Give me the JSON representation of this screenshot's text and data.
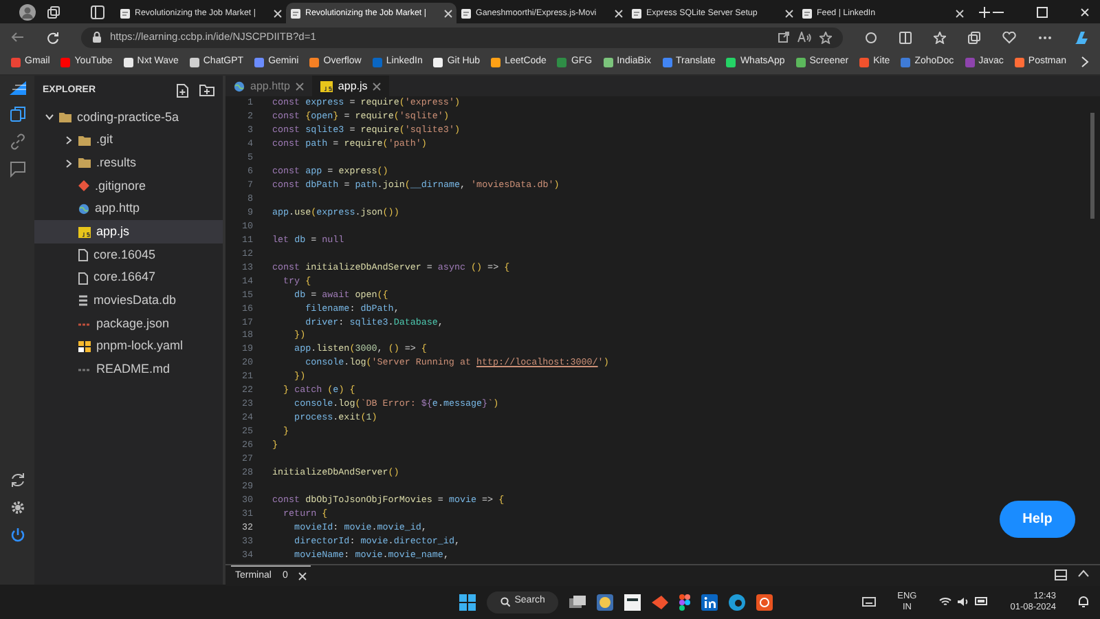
{
  "browser": {
    "tabs": [
      {
        "title": "Revolutionizing the Job Market |",
        "selected": false
      },
      {
        "title": "Revolutionizing the Job Market |",
        "selected": true
      },
      {
        "title": "Ganeshmoorthi/Express.js-Movi",
        "selected": false
      },
      {
        "title": "Express SQLite Server Setup",
        "selected": false
      },
      {
        "title": "Feed | LinkedIn",
        "selected": false
      }
    ],
    "address": "https://learning.ccbp.in/ide/NJSCPDIITB?d=1",
    "bookmarks": [
      {
        "label": "Gmail",
        "color": "#ea4335"
      },
      {
        "label": "YouTube",
        "color": "#ff0000"
      },
      {
        "label": "Nxt Wave",
        "color": "#e8e8e8"
      },
      {
        "label": "ChatGPT",
        "color": "#cfcfcf"
      },
      {
        "label": "Gemini",
        "color": "#6b8cff"
      },
      {
        "label": "Overflow",
        "color": "#f48024"
      },
      {
        "label": "LinkedIn",
        "color": "#0a66c2"
      },
      {
        "label": "Git Hub",
        "color": "#f0f0f0"
      },
      {
        "label": "LeetCode",
        "color": "#ffa116"
      },
      {
        "label": "GFG",
        "color": "#2f8d46"
      },
      {
        "label": "IndiaBix",
        "color": "#7cc47c"
      },
      {
        "label": "Translate",
        "color": "#4285f4"
      },
      {
        "label": "WhatsApp",
        "color": "#25d366"
      },
      {
        "label": "Screener",
        "color": "#5cb85c"
      },
      {
        "label": "Kite",
        "color": "#f0522d"
      },
      {
        "label": "ZohoDoc",
        "color": "#3f7bd6"
      },
      {
        "label": "Javac",
        "color": "#8e44ad"
      },
      {
        "label": "Postman",
        "color": "#ff6c37"
      }
    ]
  },
  "ide": {
    "explorer": {
      "title": "EXPLORER",
      "tree": [
        {
          "label": "coding-practice-5a",
          "kind": "folder",
          "expanded": true,
          "selected": false,
          "children": [
            {
              "label": ".git",
              "kind": "folder",
              "expanded": false,
              "selected": false
            },
            {
              "label": ".results",
              "kind": "folder",
              "expanded": false,
              "selected": false
            },
            {
              "label": ".gitignore",
              "kind": "git",
              "selected": false
            },
            {
              "label": "app.http",
              "kind": "http",
              "selected": false
            },
            {
              "label": "app.js",
              "kind": "js",
              "selected": true
            },
            {
              "label": "core.16045",
              "kind": "file",
              "selected": false
            },
            {
              "label": "core.16647",
              "kind": "file",
              "selected": false
            },
            {
              "label": "moviesData.db",
              "kind": "db",
              "selected": false
            },
            {
              "label": "package.json",
              "kind": "json",
              "selected": false
            },
            {
              "label": "pnpm-lock.yaml",
              "kind": "yaml",
              "selected": false
            },
            {
              "label": "README.md",
              "kind": "md",
              "selected": false
            }
          ]
        }
      ]
    },
    "editor": {
      "tabs": [
        {
          "label": "app.http",
          "kind": "http",
          "selected": false
        },
        {
          "label": "app.js",
          "kind": "js",
          "selected": true
        }
      ],
      "lines": [
        {
          "number": "1",
          "current": false,
          "tokens": [
            {
              "kind": "keyword",
              "text": "const "
            },
            {
              "kind": "variable",
              "text": "express"
            },
            {
              "kind": "plain",
              "text": " = "
            },
            {
              "kind": "function",
              "text": "require"
            },
            {
              "kind": "bracket",
              "text": "("
            },
            {
              "kind": "string",
              "text": "'express'"
            },
            {
              "kind": "bracket",
              "text": ")"
            }
          ]
        },
        {
          "number": "2",
          "current": false,
          "tokens": [
            {
              "kind": "keyword",
              "text": "const "
            },
            {
              "kind": "bracket",
              "text": "{"
            },
            {
              "kind": "variable",
              "text": "open"
            },
            {
              "kind": "bracket",
              "text": "}"
            },
            {
              "kind": "plain",
              "text": " = "
            },
            {
              "kind": "function",
              "text": "require"
            },
            {
              "kind": "bracket",
              "text": "("
            },
            {
              "kind": "string",
              "text": "'sqlite'"
            },
            {
              "kind": "bracket",
              "text": ")"
            }
          ]
        },
        {
          "number": "3",
          "current": false,
          "tokens": [
            {
              "kind": "keyword",
              "text": "const "
            },
            {
              "kind": "variable",
              "text": "sqlite3"
            },
            {
              "kind": "plain",
              "text": " = "
            },
            {
              "kind": "function",
              "text": "require"
            },
            {
              "kind": "bracket",
              "text": "("
            },
            {
              "kind": "string",
              "text": "'sqlite3'"
            },
            {
              "kind": "bracket",
              "text": ")"
            }
          ]
        },
        {
          "number": "4",
          "current": false,
          "tokens": [
            {
              "kind": "keyword",
              "text": "const "
            },
            {
              "kind": "variable",
              "text": "path"
            },
            {
              "kind": "plain",
              "text": " = "
            },
            {
              "kind": "function",
              "text": "require"
            },
            {
              "kind": "bracket",
              "text": "("
            },
            {
              "kind": "string",
              "text": "'path'"
            },
            {
              "kind": "bracket",
              "text": ")"
            }
          ]
        },
        {
          "number": "5",
          "current": false
        },
        {
          "number": "6",
          "current": false,
          "tokens": [
            {
              "kind": "keyword",
              "text": "const "
            },
            {
              "kind": "variable",
              "text": "app"
            },
            {
              "kind": "plain",
              "text": " = "
            },
            {
              "kind": "function",
              "text": "express"
            },
            {
              "kind": "bracket",
              "text": "()"
            }
          ]
        },
        {
          "number": "7",
          "current": false,
          "tokens": [
            {
              "kind": "keyword",
              "text": "const "
            },
            {
              "kind": "variable",
              "text": "dbPath"
            },
            {
              "kind": "plain",
              "text": " = "
            },
            {
              "kind": "variable",
              "text": "path"
            },
            {
              "kind": "plain",
              "text": "."
            },
            {
              "kind": "function",
              "text": "join"
            },
            {
              "kind": "bracket",
              "text": "("
            },
            {
              "kind": "variable",
              "text": "__dirname"
            },
            {
              "kind": "plain",
              "text": ", "
            },
            {
              "kind": "string",
              "text": "'moviesData.db'"
            },
            {
              "kind": "bracket",
              "text": ")"
            }
          ]
        },
        {
          "number": "8",
          "current": false
        },
        {
          "number": "9",
          "current": false,
          "tokens": [
            {
              "kind": "variable",
              "text": "app"
            },
            {
              "kind": "plain",
              "text": "."
            },
            {
              "kind": "function",
              "text": "use"
            },
            {
              "kind": "bracket",
              "text": "("
            },
            {
              "kind": "variable",
              "text": "express"
            },
            {
              "kind": "plain",
              "text": "."
            },
            {
              "kind": "function",
              "text": "json"
            },
            {
              "kind": "bracket",
              "text": "())"
            }
          ]
        },
        {
          "number": "10",
          "current": false
        },
        {
          "number": "11",
          "current": false,
          "tokens": [
            {
              "kind": "keyword",
              "text": "let "
            },
            {
              "kind": "variable",
              "text": "db"
            },
            {
              "kind": "plain",
              "text": " = "
            },
            {
              "kind": "keyword",
              "text": "null"
            }
          ]
        },
        {
          "number": "12",
          "current": false
        },
        {
          "number": "13",
          "current": false,
          "tokens": [
            {
              "kind": "keyword",
              "text": "const "
            },
            {
              "kind": "function",
              "text": "initializeDbAndServer"
            },
            {
              "kind": "plain",
              "text": " = "
            },
            {
              "kind": "keyword",
              "text": "async "
            },
            {
              "kind": "bracket",
              "text": "()"
            },
            {
              "kind": "plain",
              "text": " => "
            },
            {
              "kind": "bracket",
              "text": "{"
            }
          ]
        },
        {
          "number": "14",
          "current": false,
          "tokens": [
            {
              "kind": "keyword",
              "text": "  try "
            },
            {
              "kind": "bracket",
              "text": "{"
            }
          ]
        },
        {
          "number": "15",
          "current": false,
          "tokens": [
            {
              "kind": "variable",
              "text": "    db"
            },
            {
              "kind": "plain",
              "text": " = "
            },
            {
              "kind": "keyword",
              "text": "await "
            },
            {
              "kind": "function",
              "text": "open"
            },
            {
              "kind": "bracket",
              "text": "({"
            }
          ]
        },
        {
          "number": "16",
          "current": false,
          "tokens": [
            {
              "kind": "variable",
              "text": "      filename"
            },
            {
              "kind": "plain",
              "text": ": "
            },
            {
              "kind": "variable",
              "text": "dbPath"
            },
            {
              "kind": "plain",
              "text": ","
            }
          ]
        },
        {
          "number": "17",
          "current": false,
          "tokens": [
            {
              "kind": "variable",
              "text": "      driver"
            },
            {
              "kind": "plain",
              "text": ": "
            },
            {
              "kind": "variable",
              "text": "sqlite3"
            },
            {
              "kind": "plain",
              "text": "."
            },
            {
              "kind": "type",
              "text": "Database"
            },
            {
              "kind": "plain",
              "text": ","
            }
          ]
        },
        {
          "number": "18",
          "current": false,
          "tokens": [
            {
              "kind": "bracket",
              "text": "    })"
            }
          ]
        },
        {
          "number": "19",
          "current": false,
          "tokens": [
            {
              "kind": "variable",
              "text": "    app"
            },
            {
              "kind": "plain",
              "text": "."
            },
            {
              "kind": "function",
              "text": "listen"
            },
            {
              "kind": "bracket",
              "text": "("
            },
            {
              "kind": "number",
              "text": "3000"
            },
            {
              "kind": "plain",
              "text": ", "
            },
            {
              "kind": "bracket",
              "text": "()"
            },
            {
              "kind": "plain",
              "text": " => "
            },
            {
              "kind": "bracket",
              "text": "{"
            }
          ]
        },
        {
          "number": "20",
          "current": false,
          "tokens": [
            {
              "kind": "variable",
              "text": "      console"
            },
            {
              "kind": "plain",
              "text": "."
            },
            {
              "kind": "function",
              "text": "log"
            },
            {
              "kind": "bracket",
              "text": "("
            },
            {
              "kind": "string",
              "text": "'Server Running at "
            },
            {
              "kind": "link",
              "text": "http://localhost:3000/"
            },
            {
              "kind": "string",
              "text": "'"
            },
            {
              "kind": "bracket",
              "text": ")"
            }
          ]
        },
        {
          "number": "21",
          "current": false,
          "tokens": [
            {
              "kind": "bracket",
              "text": "    })"
            }
          ]
        },
        {
          "number": "22",
          "current": false,
          "tokens": [
            {
              "kind": "bracket",
              "text": "  } "
            },
            {
              "kind": "keyword",
              "text": "catch "
            },
            {
              "kind": "bracket",
              "text": "("
            },
            {
              "kind": "variable",
              "text": "e"
            },
            {
              "kind": "bracket",
              "text": ") {"
            }
          ]
        },
        {
          "number": "23",
          "current": false,
          "tokens": [
            {
              "kind": "variable",
              "text": "    console"
            },
            {
              "kind": "plain",
              "text": "."
            },
            {
              "kind": "function",
              "text": "log"
            },
            {
              "kind": "bracket",
              "text": "("
            },
            {
              "kind": "string",
              "text": "`DB Error: "
            },
            {
              "kind": "keyword",
              "text": "${"
            },
            {
              "kind": "variable",
              "text": "e"
            },
            {
              "kind": "plain",
              "text": "."
            },
            {
              "kind": "variable",
              "text": "message"
            },
            {
              "kind": "keyword",
              "text": "}"
            },
            {
              "kind": "string",
              "text": "`"
            },
            {
              "kind": "bracket",
              "text": ")"
            }
          ]
        },
        {
          "number": "24",
          "current": false,
          "tokens": [
            {
              "kind": "variable",
              "text": "    process"
            },
            {
              "kind": "plain",
              "text": "."
            },
            {
              "kind": "function",
              "text": "exit"
            },
            {
              "kind": "bracket",
              "text": "("
            },
            {
              "kind": "number",
              "text": "1"
            },
            {
              "kind": "bracket",
              "text": ")"
            }
          ]
        },
        {
          "number": "25",
          "current": false,
          "tokens": [
            {
              "kind": "bracket",
              "text": "  }"
            }
          ]
        },
        {
          "number": "26",
          "current": false,
          "tokens": [
            {
              "kind": "bracket",
              "text": "}"
            }
          ]
        },
        {
          "number": "27",
          "current": false
        },
        {
          "number": "28",
          "current": false,
          "tokens": [
            {
              "kind": "function",
              "text": "initializeDbAndServer"
            },
            {
              "kind": "bracket",
              "text": "()"
            }
          ]
        },
        {
          "number": "29",
          "current": false
        },
        {
          "number": "30",
          "current": false,
          "tokens": [
            {
              "kind": "keyword",
              "text": "const "
            },
            {
              "kind": "function",
              "text": "dbObjToJsonObjForMovies"
            },
            {
              "kind": "plain",
              "text": " = "
            },
            {
              "kind": "variable",
              "text": "movie"
            },
            {
              "kind": "plain",
              "text": " => "
            },
            {
              "kind": "bracket",
              "text": "{"
            }
          ]
        },
        {
          "number": "31",
          "current": false,
          "tokens": [
            {
              "kind": "keyword",
              "text": "  return "
            },
            {
              "kind": "bracket",
              "text": "{"
            }
          ]
        },
        {
          "number": "32",
          "current": true,
          "tokens": [
            {
              "kind": "variable",
              "text": "    movieId"
            },
            {
              "kind": "plain",
              "text": ": "
            },
            {
              "kind": "variable",
              "text": "movie"
            },
            {
              "kind": "plain",
              "text": "."
            },
            {
              "kind": "variable",
              "text": "movie_id"
            },
            {
              "kind": "plain",
              "text": ","
            }
          ]
        },
        {
          "number": "33",
          "current": false,
          "tokens": [
            {
              "kind": "variable",
              "text": "    directorId"
            },
            {
              "kind": "plain",
              "text": ": "
            },
            {
              "kind": "variable",
              "text": "movie"
            },
            {
              "kind": "plain",
              "text": "."
            },
            {
              "kind": "variable",
              "text": "director_id"
            },
            {
              "kind": "plain",
              "text": ","
            }
          ]
        },
        {
          "number": "34",
          "current": false,
          "tokens": [
            {
              "kind": "variable",
              "text": "    movieName"
            },
            {
              "kind": "plain",
              "text": ": "
            },
            {
              "kind": "variable",
              "text": "movie"
            },
            {
              "kind": "plain",
              "text": "."
            },
            {
              "kind": "variable",
              "text": "movie_name"
            },
            {
              "kind": "plain",
              "text": ","
            }
          ]
        }
      ]
    },
    "help_button": "Help",
    "panel": {
      "tab": "Terminal",
      "count": "0"
    }
  },
  "taskbar": {
    "search": "Search",
    "language": "ENG",
    "region": "IN",
    "time": "12:43",
    "date": "01-08-2024"
  }
}
